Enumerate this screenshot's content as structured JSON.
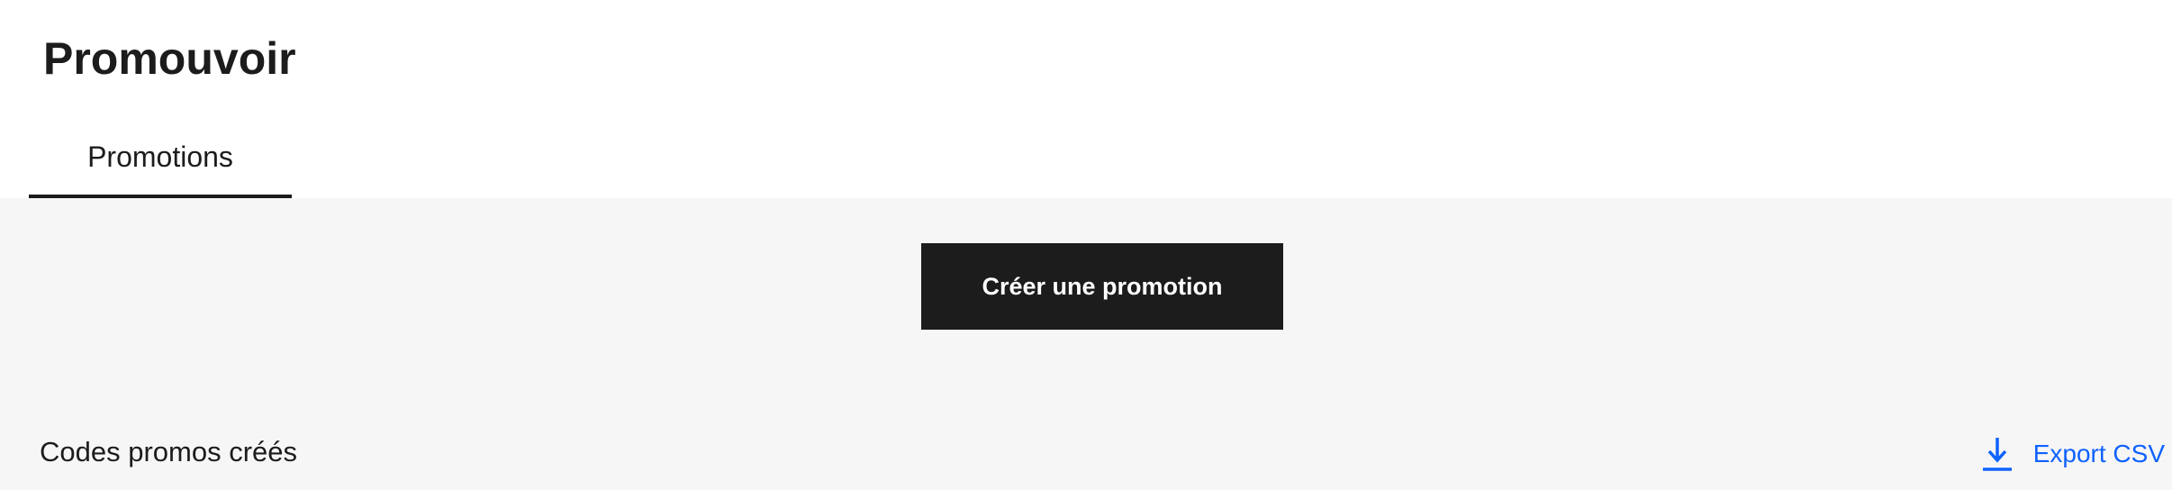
{
  "header": {
    "title": "Promouvoir",
    "tabs": [
      {
        "label": "Promotions",
        "active": true
      }
    ]
  },
  "main": {
    "create_button_label": "Créer une promotion",
    "section_title": "Codes promos créés",
    "export": {
      "label": "Export CSV",
      "icon": "download-icon"
    }
  },
  "colors": {
    "text": "#1c1c1c",
    "background": "#f6f6f6",
    "button_bg": "#1c1c1c",
    "button_text": "#ffffff",
    "link": "#0f62fe"
  }
}
